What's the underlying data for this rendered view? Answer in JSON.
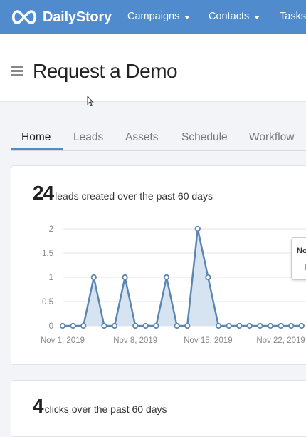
{
  "app": {
    "brand": "DailyStory",
    "nav": [
      {
        "label": "Campaigns"
      },
      {
        "label": "Contacts"
      },
      {
        "label": "Tasks"
      }
    ]
  },
  "page": {
    "title": "Request a Demo"
  },
  "tabs": [
    {
      "label": "Home",
      "active": true
    },
    {
      "label": "Leads"
    },
    {
      "label": "Assets"
    },
    {
      "label": "Schedule"
    },
    {
      "label": "Workflow"
    }
  ],
  "leads_card": {
    "number": "24",
    "label": "leads created over the past 60 days"
  },
  "clicks_card": {
    "number": "4",
    "label": "clicks over the past 60 days"
  },
  "tooltip": {
    "title": "No"
  },
  "colors": {
    "brand": "#4f8bcd",
    "series_line": "#5b86b1",
    "series_fill": "#d6e4f2"
  },
  "chart_data": {
    "type": "area",
    "title": "",
    "xlabel": "",
    "ylabel": "",
    "ylim": [
      0,
      2
    ],
    "yticks": [
      "2",
      "1.5",
      "1",
      "0.5",
      "0"
    ],
    "xtick_labels": [
      "Nov 1, 2019",
      "Nov 8, 2019",
      "Nov 15, 2019",
      "Nov 22, 2019"
    ],
    "x": [
      "Nov 1",
      "Nov 2",
      "Nov 3",
      "Nov 4",
      "Nov 5",
      "Nov 6",
      "Nov 7",
      "Nov 8",
      "Nov 9",
      "Nov 10",
      "Nov 11",
      "Nov 12",
      "Nov 13",
      "Nov 14",
      "Nov 15",
      "Nov 16",
      "Nov 17",
      "Nov 18",
      "Nov 19",
      "Nov 20",
      "Nov 21",
      "Nov 22",
      "Nov 23",
      "Nov 24"
    ],
    "series": [
      {
        "values": [
          0,
          0,
          0,
          1,
          0,
          0,
          1,
          0,
          0,
          0,
          1,
          0,
          0,
          2,
          1,
          0,
          0,
          0,
          0,
          0,
          0,
          0,
          0,
          0
        ]
      }
    ],
    "grid": true,
    "legend": "none"
  }
}
